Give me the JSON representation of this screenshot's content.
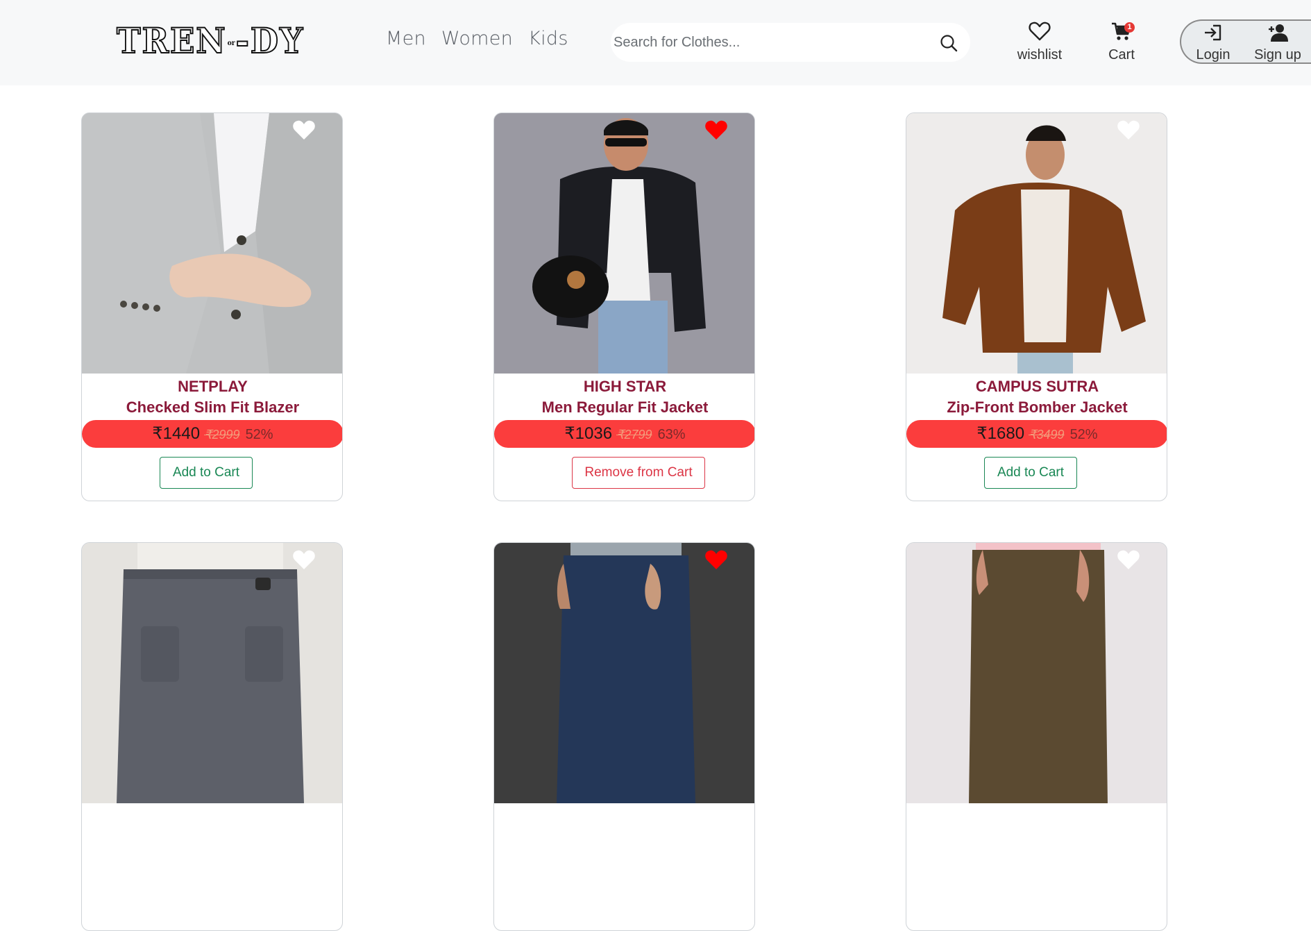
{
  "header": {
    "logo_text": "TREN-DY",
    "logo_mini": "or",
    "nav": [
      "Men",
      "Women",
      "Kids"
    ],
    "search_placeholder": "Search for Clothes...",
    "wishlist_label": "wishlist",
    "cart_label": "Cart",
    "cart_count": "1",
    "login_label": "Login",
    "signup_label": "Sign up"
  },
  "products": [
    {
      "brand": "NETPLAY",
      "title": "Checked Slim Fit Blazer",
      "price": "₹1440",
      "mrp": "₹2999",
      "discount": "52%",
      "button": "Add to Cart",
      "wishlisted": false,
      "in_cart": false
    },
    {
      "brand": "HIGH STAR",
      "title": "Men Regular Fit Jacket",
      "price": "₹1036",
      "mrp": "₹2799",
      "discount": "63%",
      "button": "Remove from Cart",
      "wishlisted": true,
      "in_cart": true
    },
    {
      "brand": "CAMPUS SUTRA",
      "title": "Zip-Front Bomber Jacket",
      "price": "₹1680",
      "mrp": "₹3499",
      "discount": "52%",
      "button": "Add to Cart",
      "wishlisted": false,
      "in_cart": false
    },
    {
      "wishlisted": false
    },
    {
      "wishlisted": true
    },
    {
      "wishlisted": false
    }
  ],
  "colors": {
    "brand_text": "#8b1a3a",
    "price_bar": "#fb3d3d",
    "add_btn": "#198754",
    "remove_btn": "#dc3545",
    "heart_active": "#ff0000"
  }
}
